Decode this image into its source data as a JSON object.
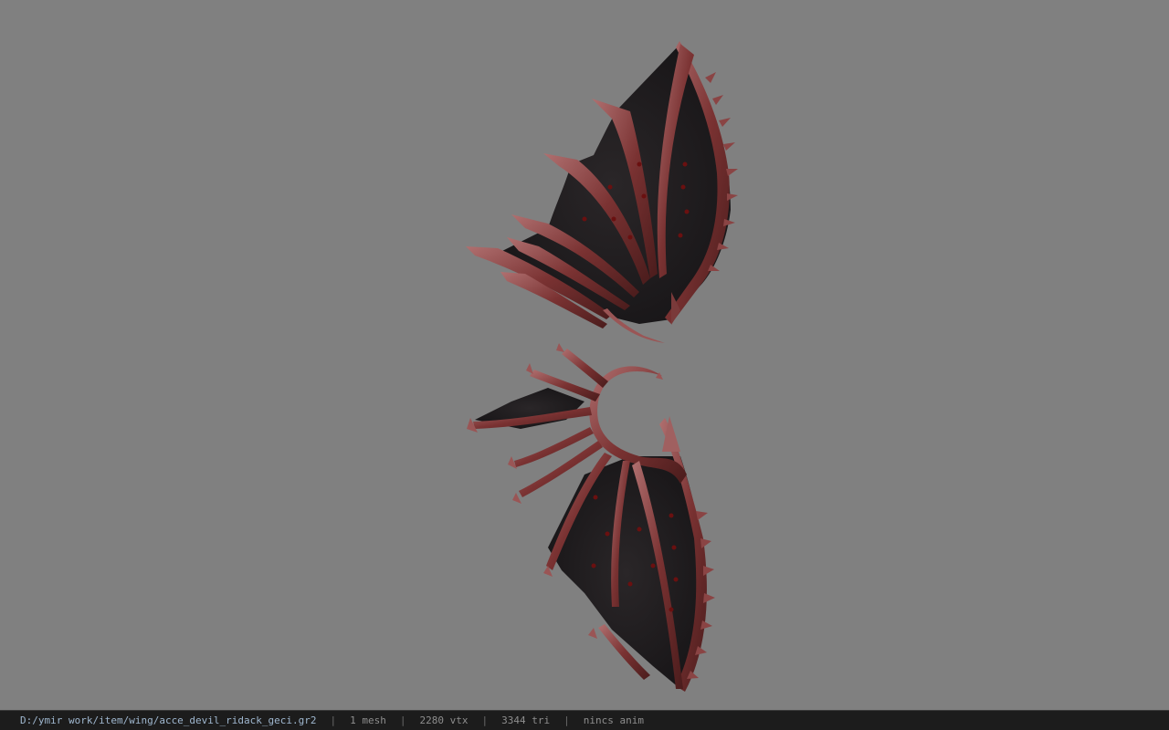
{
  "viewport": {
    "background_color": "#808080",
    "model": "demon-wing-pair",
    "colors": {
      "membrane": "#1c1a1c",
      "bone": "#7a3232",
      "bone_highlight": "#b07070",
      "spots": "#6a1010"
    }
  },
  "status_bar": {
    "file_path": "D:/ymir work/item/wing/acce_devil_ridack_geci.gr2",
    "mesh_count": "1 mesh",
    "vertex_count": "2280 vtx",
    "triangle_count": "3344 tri",
    "animation": "nincs anim",
    "separator": "|"
  }
}
